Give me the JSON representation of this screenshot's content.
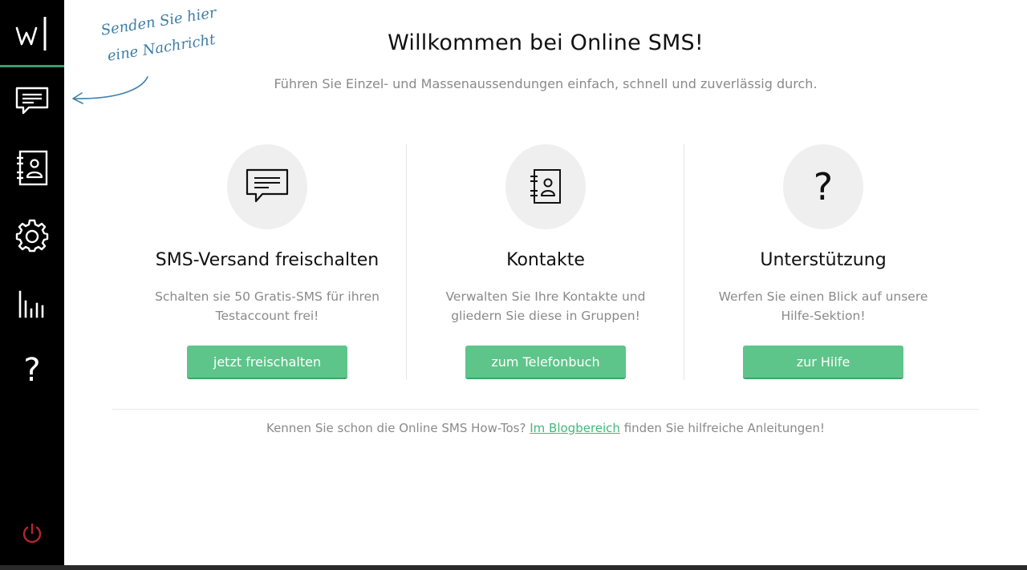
{
  "sidebar": {
    "logo_text": "W|",
    "items": [
      {
        "name": "sms",
        "icon": "message-icon"
      },
      {
        "name": "contacts",
        "icon": "address-book-icon"
      },
      {
        "name": "settings",
        "icon": "gear-icon"
      },
      {
        "name": "statistics",
        "icon": "bar-chart-icon"
      },
      {
        "name": "help",
        "icon": "question-icon",
        "label": "?"
      }
    ],
    "power_icon": "power-icon",
    "power_color": "#b3262b",
    "accent": "#3d9a6d"
  },
  "hint": {
    "line1": "Senden Sie hier",
    "line2": "eine Nachricht",
    "color": "#3f7fa6"
  },
  "header": {
    "title": "Willkommen bei Online SMS!",
    "subtitle": "Führen Sie Einzel- und Massenaussendungen einfach, schnell und zuverlässig durch."
  },
  "cards": [
    {
      "icon": "message-icon",
      "title": "SMS-Versand freischalten",
      "desc_line1": "Schalten sie 50 Gratis-SMS für ihren",
      "desc_line2": "Testaccount frei!",
      "button": "jetzt freischalten"
    },
    {
      "icon": "address-book-icon",
      "title": "Kontakte",
      "desc_line1": "Verwalten Sie Ihre Kontakte und",
      "desc_line2": "gliedern Sie diese in Gruppen!",
      "button": "zum Telefonbuch"
    },
    {
      "icon": "question-icon",
      "icon_glyph": "?",
      "title": "Unterstützung",
      "desc_line1": "Werfen Sie einen Blick auf unsere",
      "desc_line2": "Hilfe-Sektion!",
      "button": "zur Hilfe"
    }
  ],
  "footer": {
    "before": "Kennen Sie schon die Online SMS How-Tos?",
    "link": "Im Blogbereich",
    "after": "finden Sie hilfreiche Anleitungen!"
  },
  "colors": {
    "button": "#5dc589",
    "link": "#45b87a",
    "muted_text": "#8a8a8a"
  }
}
